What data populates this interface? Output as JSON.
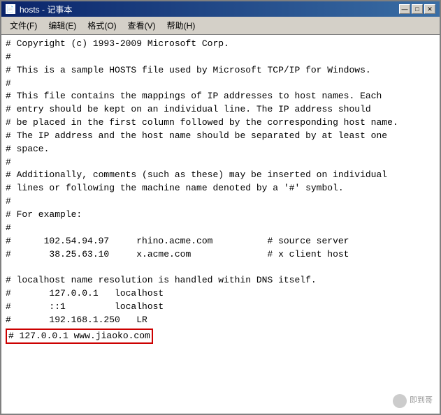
{
  "window": {
    "title": "hosts - 记事本",
    "titleIcon": "📄"
  },
  "titleButtons": {
    "minimize": "—",
    "maximize": "□",
    "close": "✕"
  },
  "menuBar": {
    "items": [
      "文件(F)",
      "编辑(E)",
      "格式(O)",
      "查看(V)",
      "帮助(H)"
    ]
  },
  "content": {
    "lines": [
      "# Copyright (c) 1993-2009 Microsoft Corp.",
      "#",
      "# This is a sample HOSTS file used by Microsoft TCP/IP for Windows.",
      "#",
      "# This file contains the mappings of IP addresses to host names. Each",
      "# entry should be kept on an individual line. The IP address should",
      "# be placed in the first column followed by the corresponding host name.",
      "# The IP address and the host name should be separated by at least one",
      "# space.",
      "#",
      "# Additionally, comments (such as these) may be inserted on individual",
      "# lines or following the machine name denoted by a '#' symbol.",
      "#",
      "# For example:",
      "#",
      "#      102.54.94.97     rhino.acme.com          # source server",
      "#       38.25.63.10     x.acme.com              # x client host",
      "",
      "# localhost name resolution is handled within DNS itself.",
      "#       127.0.0.1   localhost",
      "#       ::1         localhost",
      "#       192.168.1.250   LR"
    ],
    "highlightedLine": "#    127.0.0.1        www.jiaoko.com"
  },
  "watermark": {
    "text": "即到哥"
  }
}
